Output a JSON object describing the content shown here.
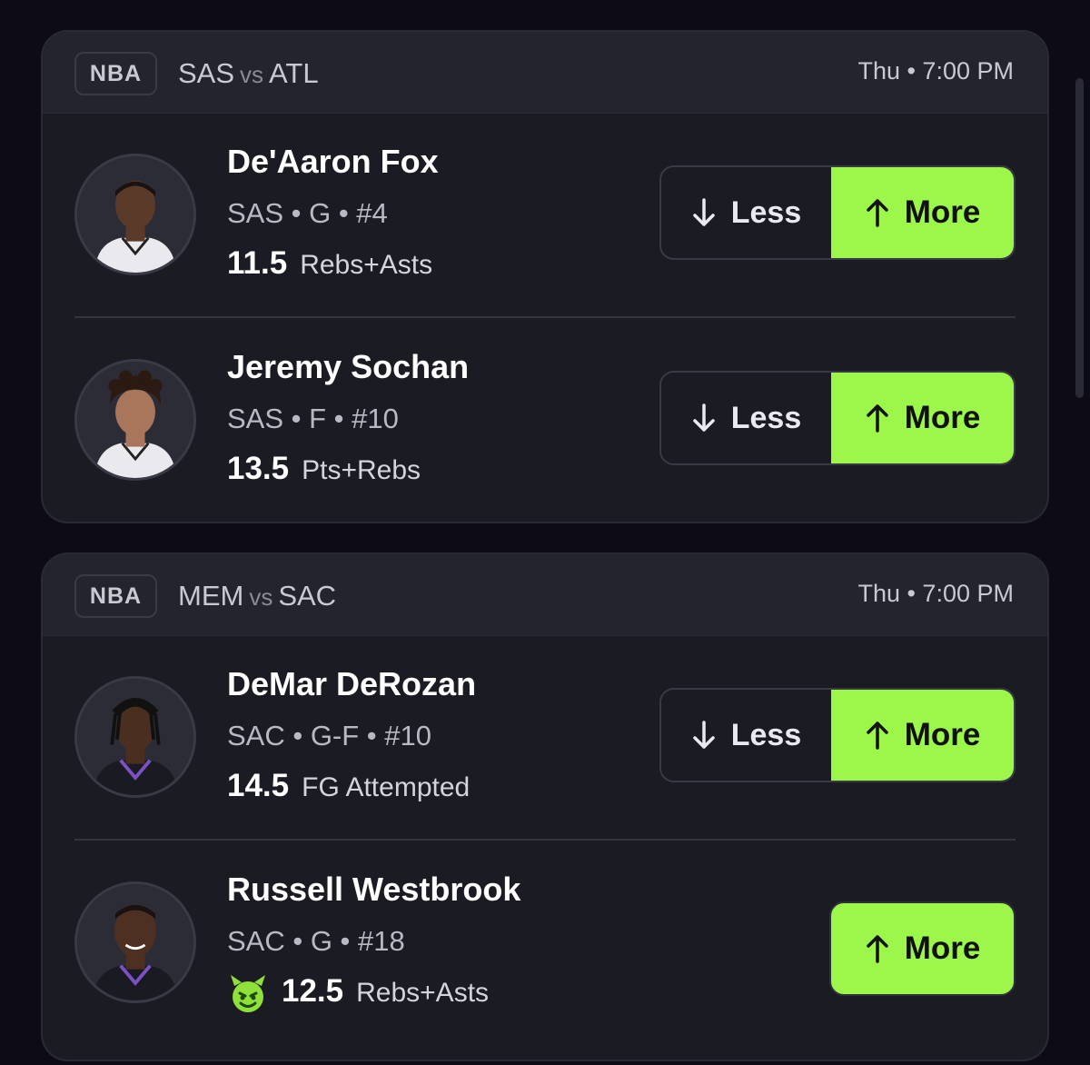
{
  "colors": {
    "background": "#0c0b16",
    "card": "#1b1b24",
    "card_header": "#24242e",
    "more_accent": "#9cf74a",
    "demon_green": "#8fe03a"
  },
  "games": [
    {
      "league": "NBA",
      "team1": "SAS",
      "vs": "vs",
      "team2": "ATL",
      "time": "Thu • 7:00 PM",
      "players": [
        {
          "name": "De'Aaron Fox",
          "meta": "SAS • G • #4",
          "line_value": "11.5",
          "line_stat": "Rebs+Asts",
          "less_label": "Less",
          "more_label": "More"
        },
        {
          "name": "Jeremy Sochan",
          "meta": "SAS • F • #10",
          "line_value": "13.5",
          "line_stat": "Pts+Rebs",
          "less_label": "Less",
          "more_label": "More"
        }
      ]
    },
    {
      "league": "NBA",
      "team1": "MEM",
      "vs": "vs",
      "team2": "SAC",
      "time": "Thu • 7:00 PM",
      "players": [
        {
          "name": "DeMar DeRozan",
          "meta": "SAC • G-F • #10",
          "line_value": "14.5",
          "line_stat": "FG Attempted",
          "less_label": "Less",
          "more_label": "More"
        },
        {
          "name": "Russell Westbrook",
          "meta": "SAC • G • #18",
          "line_value": "12.5",
          "line_stat": "Rebs+Asts",
          "more_label": "More",
          "icon": "demon-icon"
        }
      ]
    }
  ]
}
